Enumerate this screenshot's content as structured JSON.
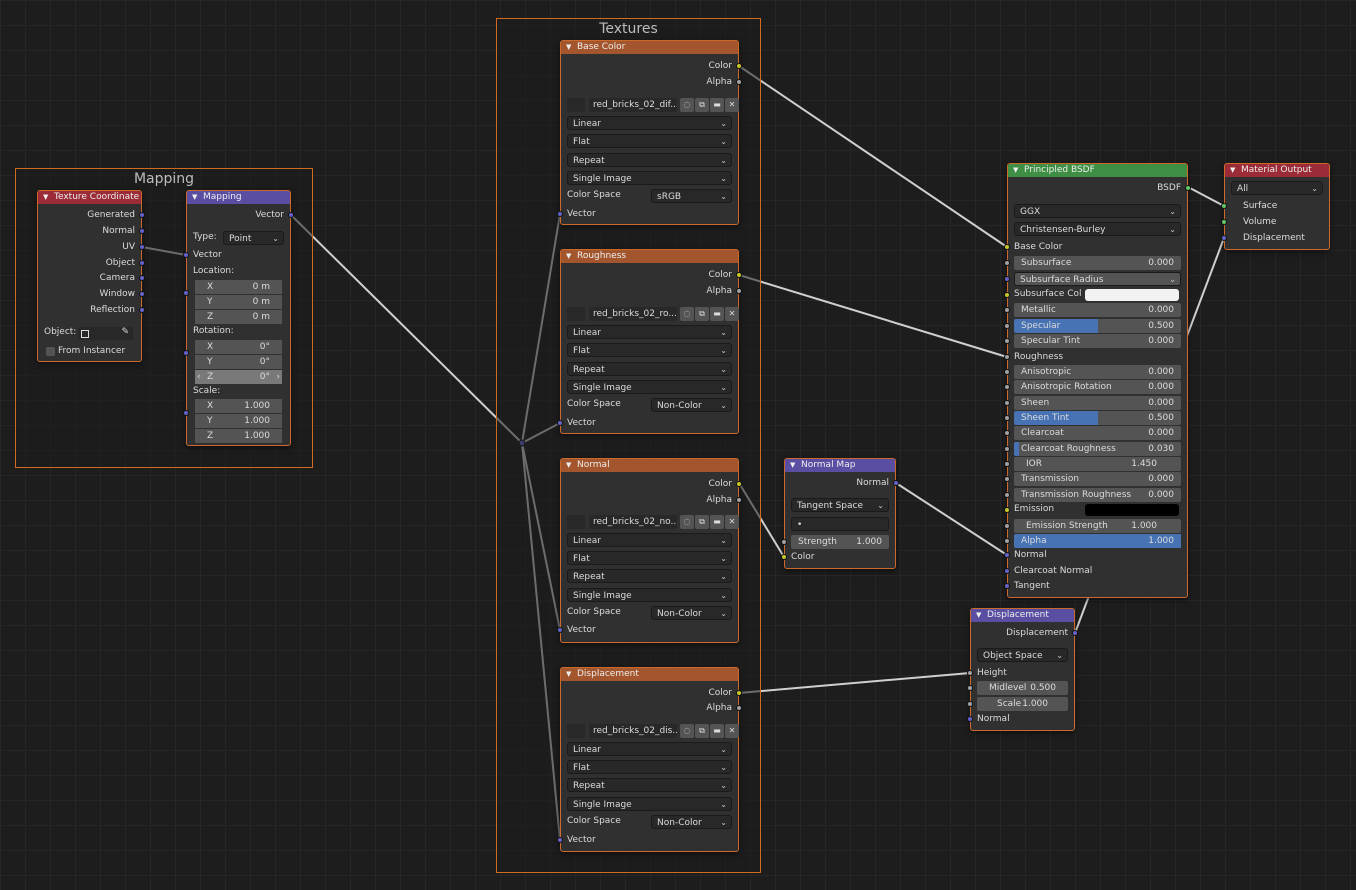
{
  "frames": {
    "mapping": "Mapping",
    "textures": "Textures"
  },
  "texcoord": {
    "title": "Texture Coordinate",
    "outputs": [
      "Generated",
      "Normal",
      "UV",
      "Object",
      "Camera",
      "Window",
      "Reflection"
    ],
    "object_label": "Object:",
    "from_instancer": "From Instancer"
  },
  "mapping": {
    "title": "Mapping",
    "output": "Vector",
    "type_label": "Type:",
    "type_value": "Point",
    "input_vector": "Vector",
    "location_label": "Location:",
    "location": [
      {
        "axis": "X",
        "value": "0 m"
      },
      {
        "axis": "Y",
        "value": "0 m"
      },
      {
        "axis": "Z",
        "value": "0 m"
      }
    ],
    "rotation_label": "Rotation:",
    "rotation": [
      {
        "axis": "X",
        "value": "0°"
      },
      {
        "axis": "Y",
        "value": "0°"
      },
      {
        "axis": "Z",
        "value": "0°"
      }
    ],
    "scale_label": "Scale:",
    "scale": [
      {
        "axis": "X",
        "value": "1.000"
      },
      {
        "axis": "Y",
        "value": "1.000"
      },
      {
        "axis": "Z",
        "value": "1.000"
      }
    ]
  },
  "image_nodes": [
    {
      "title": "Base Color",
      "image": "red_bricks_02_dif...",
      "color_space": "sRGB"
    },
    {
      "title": "Roughness",
      "image": "red_bricks_02_ro...",
      "color_space": "Non-Color"
    },
    {
      "title": "Normal",
      "image": "red_bricks_02_no...",
      "color_space": "Non-Color"
    },
    {
      "title": "Displacement",
      "image": "red_bricks_02_dis...",
      "color_space": "Non-Color"
    }
  ],
  "image_common": {
    "out_color": "Color",
    "out_alpha": "Alpha",
    "interpolation": "Linear",
    "projection": "Flat",
    "extension": "Repeat",
    "source": "Single Image",
    "color_space_label": "Color Space",
    "vector": "Vector"
  },
  "normal_map": {
    "title": "Normal Map",
    "output": "Normal",
    "space": "Tangent Space",
    "uv": "•",
    "strength_label": "Strength",
    "strength_value": "1.000",
    "input_color": "Color"
  },
  "bsdf": {
    "title": "Principled BSDF",
    "output": "BSDF",
    "distribution": "GGX",
    "subsurface_method": "Christensen-Burley",
    "base_color": "Base Color",
    "subsurface": {
      "label": "Subsurface",
      "value": "0.000"
    },
    "subsurface_radius": "Subsurface Radius",
    "subsurface_color": "Subsurface Col",
    "metallic": {
      "label": "Metallic",
      "value": "0.000",
      "fill": 0
    },
    "specular": {
      "label": "Specular",
      "value": "0.500",
      "fill": 0.5
    },
    "specular_tint": {
      "label": "Specular Tint",
      "value": "0.000",
      "fill": 0
    },
    "roughness": "Roughness",
    "anisotropic": {
      "label": "Anisotropic",
      "value": "0.000",
      "fill": 0
    },
    "anisotropic_rotation": {
      "label": "Anisotropic Rotation",
      "value": "0.000",
      "fill": 0
    },
    "sheen": {
      "label": "Sheen",
      "value": "0.000",
      "fill": 0
    },
    "sheen_tint": {
      "label": "Sheen Tint",
      "value": "0.500",
      "fill": 0.5
    },
    "clearcoat": {
      "label": "Clearcoat",
      "value": "0.000",
      "fill": 0
    },
    "clearcoat_roughness": {
      "label": "Clearcoat Roughness",
      "value": "0.030",
      "fill": 0.03
    },
    "ior": {
      "label": "IOR",
      "value": "1.450"
    },
    "transmission": {
      "label": "Transmission",
      "value": "0.000",
      "fill": 0
    },
    "transmission_roughness": {
      "label": "Transmission Roughness",
      "value": "0.000",
      "fill": 0
    },
    "emission": "Emission",
    "emission_strength": {
      "label": "Emission Strength",
      "value": "1.000"
    },
    "alpha": {
      "label": "Alpha",
      "value": "1.000",
      "fill": 1
    },
    "normal": "Normal",
    "clearcoat_normal": "Clearcoat Normal",
    "tangent": "Tangent"
  },
  "material_output": {
    "title": "Material Output",
    "target": "All",
    "surface": "Surface",
    "volume": "Volume",
    "displacement": "Displacement"
  },
  "displacement": {
    "title": "Displacement",
    "output": "Displacement",
    "space": "Object Space",
    "height": "Height",
    "midlevel": {
      "label": "Midlevel",
      "value": "0.500"
    },
    "scale": {
      "label": "Scale",
      "value": "1.000"
    },
    "normal": "Normal"
  },
  "colors": {
    "frame": "#d2691e",
    "texture_header": "#a3562d",
    "input_header": "#9a2b37",
    "vector_header": "#5a4ea3",
    "shader_header": "#3e8e43",
    "slider_fill": "#4772b3"
  }
}
